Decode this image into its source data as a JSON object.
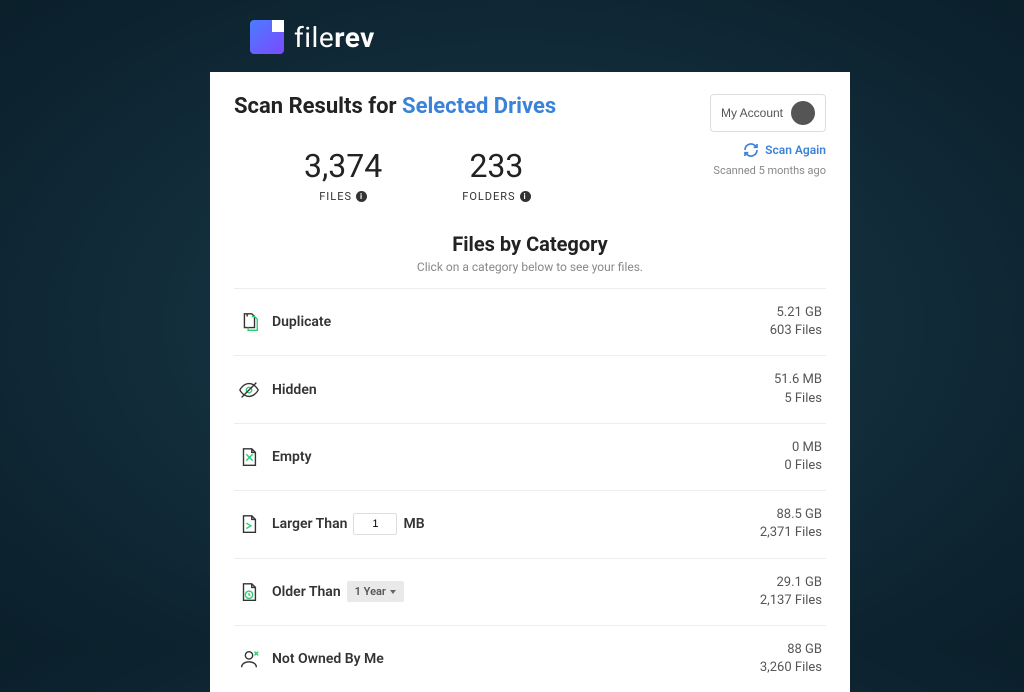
{
  "brand": {
    "part1": "file",
    "part2": "rev"
  },
  "header": {
    "title_prefix": "Scan Results for ",
    "title_link": "Selected Drives",
    "account_label": "My Account",
    "scan_again": "Scan Again",
    "scanned_ago": "Scanned 5 months ago"
  },
  "stats": {
    "files_count": "3,374",
    "files_label": "FILES",
    "folders_count": "233",
    "folders_label": "FOLDERS"
  },
  "section": {
    "title": "Files by Category",
    "subtitle": "Click on a category below to see your files."
  },
  "categories": [
    {
      "label": "Duplicate",
      "size": "5.21 GB",
      "files": "603 Files"
    },
    {
      "label": "Hidden",
      "size": "51.6 MB",
      "files": "5 Files"
    },
    {
      "label": "Empty",
      "size": "0 MB",
      "files": "0 Files"
    },
    {
      "label_pre": "Larger Than",
      "threshold_value": "1",
      "label_post": "MB",
      "size": "88.5 GB",
      "files": "2,371 Files"
    },
    {
      "label_pre": "Older Than",
      "dropdown_value": "1 Year",
      "size": "29.1 GB",
      "files": "2,137 Files"
    },
    {
      "label": "Not Owned By Me",
      "size": "88 GB",
      "files": "3,260 Files"
    }
  ]
}
